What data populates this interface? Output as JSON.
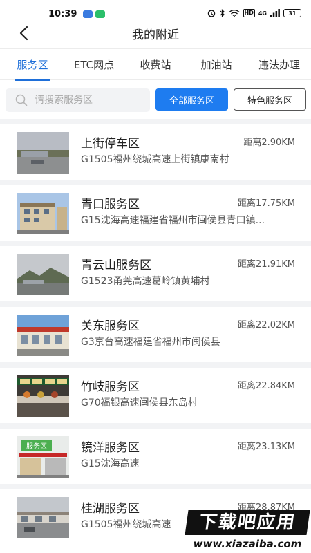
{
  "status_bar": {
    "time": "10:39",
    "hd": "HD",
    "network": "4G",
    "battery": "31"
  },
  "header": {
    "title": "我的附近"
  },
  "tabs": [
    {
      "label": "服务区",
      "active": true
    },
    {
      "label": "ETC网点",
      "active": false
    },
    {
      "label": "收费站",
      "active": false
    },
    {
      "label": "加油站",
      "active": false
    },
    {
      "label": "违法办理",
      "active": false
    }
  ],
  "search": {
    "placeholder": "请搜索服务区"
  },
  "filters": {
    "all_label": "全部服务区",
    "special_label": "特色服务区"
  },
  "items": [
    {
      "name": "上街停车区",
      "distance": "距离2.90KM",
      "address": "G1505福州绕城高速上街镇康南村"
    },
    {
      "name": "青口服务区",
      "distance": "距离17.75KM",
      "address": "G15沈海高速福建省福州市闽侯县青口镇..."
    },
    {
      "name": "青云山服务区",
      "distance": "距离21.91KM",
      "address": "G1523甬莞高速葛岭镇黄埔村"
    },
    {
      "name": "关东服务区",
      "distance": "距离22.02KM",
      "address": "G3京台高速福建省福州市闽侯县"
    },
    {
      "name": "竹岐服务区",
      "distance": "距离22.84KM",
      "address": "G70福银高速闽侯县东岛村"
    },
    {
      "name": "镜洋服务区",
      "distance": "距离23.13KM",
      "address": "G15沈海高速"
    },
    {
      "name": "桂湖服务区",
      "distance": "距离28.87KM",
      "address": "G1505福州绕城高速"
    }
  ],
  "thumb_sign_text": "服务区",
  "watermark": {
    "title": "下载吧应用",
    "url": "www.xiazaiba.com"
  },
  "colors": {
    "accent": "#1e7cf0",
    "tab_active": "#1e6fd9",
    "divider": "#f2f3f5"
  }
}
